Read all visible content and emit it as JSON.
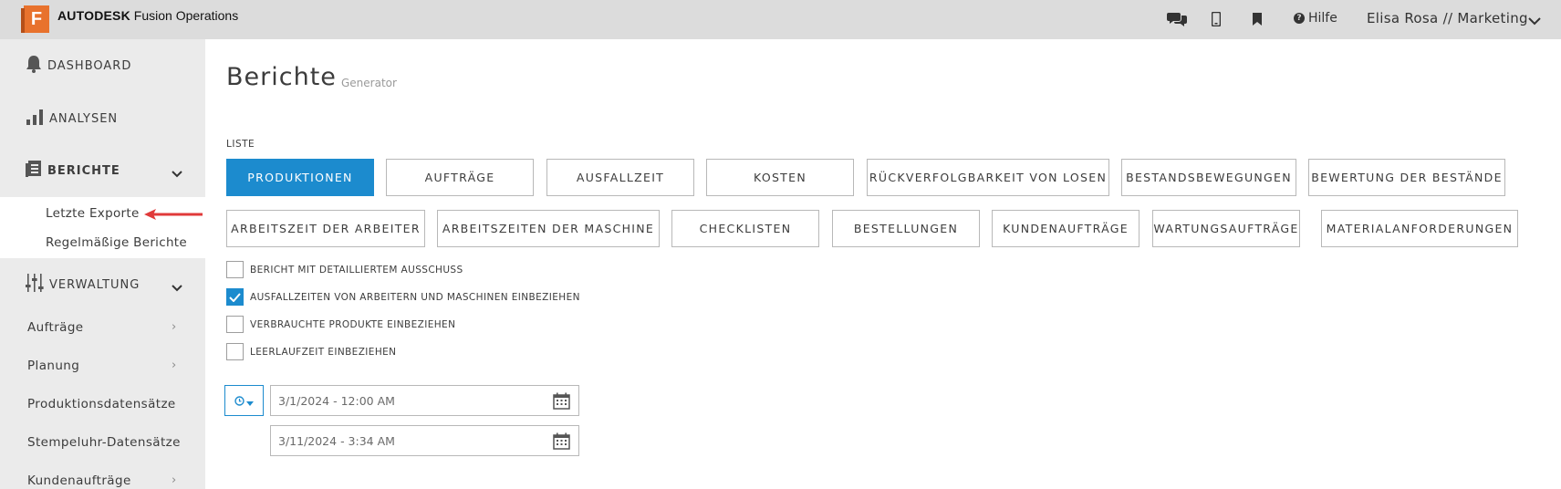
{
  "header": {
    "logo_letter": "F",
    "brand_bold": "AUTODESK",
    "brand_rest": " Fusion Operations",
    "help_label": "Hilfe",
    "user_label": "Elisa Rosa // Marketing",
    "icons": [
      "chat-icon",
      "mobile-icon",
      "bookmark-icon",
      "help-icon",
      "chevron-down-icon"
    ]
  },
  "sidebar": {
    "dashboard": "DASHBOARD",
    "analysen": "ANALYSEN",
    "berichte": "BERICHTE",
    "berichte_sub": [
      "Letzte Exporte",
      "Regelmäßige Berichte"
    ],
    "verwaltung": "VERWALTUNG",
    "links": [
      "Aufträge",
      "Planung",
      "Produktionsdatensätze",
      "Stempeluhr-Datensätze",
      "Kundenaufträge"
    ]
  },
  "page": {
    "title": "Berichte",
    "subtitle": "Generator",
    "list_label": "LISTE"
  },
  "report_types": [
    "PRODUKTIONEN",
    "AUFTRÄGE",
    "AUSFALLZEIT",
    "KOSTEN",
    "RÜCKVERFOLGBARKEIT VON LOSEN",
    "BESTANDSBEWEGUNGEN",
    "BEWERTUNG DER BESTÄNDE",
    "ARBEITSZEIT DER ARBEITER",
    "ARBEITSZEITEN DER MASCHINE",
    "CHECKLISTEN",
    "BESTELLUNGEN",
    "KUNDENAUFTRÄGE",
    "WARTUNGSAUFTRÄGE",
    "MATERIALANFORDERUNGEN"
  ],
  "selected_report": "PRODUKTIONEN",
  "options": [
    {
      "label": "BERICHT MIT DETAILLIERTEM AUSSCHUSS",
      "checked": false
    },
    {
      "label": "AUSFALLZEITEN VON ARBEITERN UND MASCHINEN EINBEZIEHEN",
      "checked": true
    },
    {
      "label": "VERBRAUCHTE PRODUKTE EINBEZIEHEN",
      "checked": false
    },
    {
      "label": "LEERLAUFZEIT EINBEZIEHEN",
      "checked": false
    }
  ],
  "date_range": {
    "start": "3/1/2024 - 12:00 AM",
    "end": "3/11/2024 - 3:34 AM"
  },
  "colors": {
    "accent": "#1c8bce",
    "brand_orange": "#e8722d",
    "arrow_red": "#e03a3a",
    "sidebar_bg": "#ebebeb",
    "topbar_bg": "#dcdcdc"
  }
}
